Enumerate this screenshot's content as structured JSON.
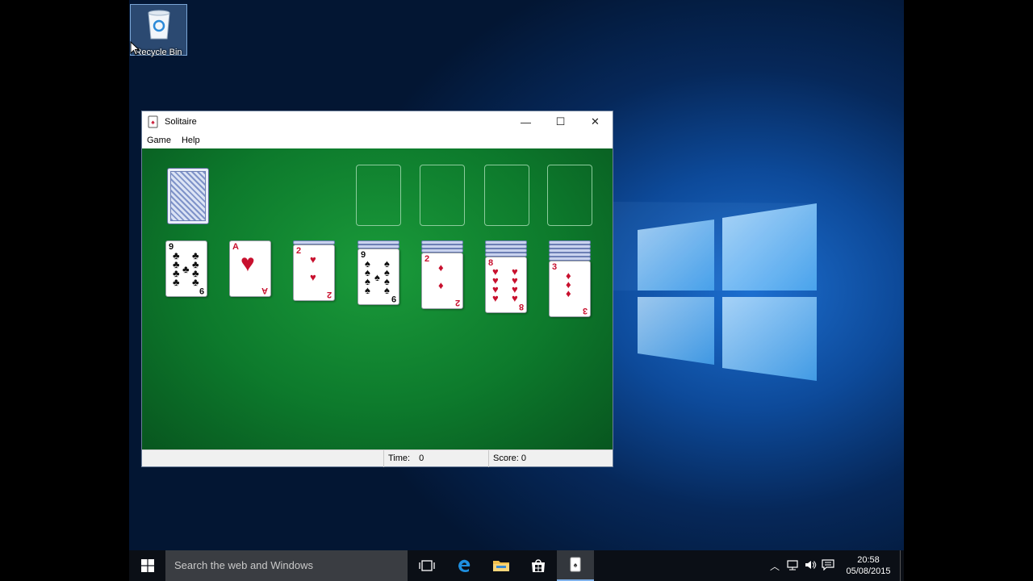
{
  "desktop": {
    "recycle_bin_label": "Recycle Bin"
  },
  "window": {
    "title": "Solitaire",
    "minimize_glyph": "—",
    "maximize_glyph": "☐",
    "close_glyph": "✕",
    "menu": [
      {
        "label": "Game"
      },
      {
        "label": "Help"
      }
    ]
  },
  "game": {
    "stock": "face-down",
    "foundations": 4,
    "tableau": [
      {
        "hidden": 0,
        "rank": "9",
        "suit": "♣",
        "color": "black"
      },
      {
        "hidden": 0,
        "rank": "A",
        "suit": "♥",
        "color": "red"
      },
      {
        "hidden": 1,
        "rank": "2",
        "suit": "♥",
        "color": "red"
      },
      {
        "hidden": 2,
        "rank": "9",
        "suit": "♠",
        "color": "black"
      },
      {
        "hidden": 3,
        "rank": "2",
        "suit": "♦",
        "color": "red"
      },
      {
        "hidden": 4,
        "rank": "8",
        "suit": "♥",
        "color": "red"
      },
      {
        "hidden": 5,
        "rank": "3",
        "suit": "♦",
        "color": "red"
      }
    ]
  },
  "status": {
    "time_label": "Time:",
    "time_value": "0",
    "score_label": "Score: 0"
  },
  "taskbar": {
    "search_placeholder": "Search the web and Windows",
    "clock_time": "20:58",
    "clock_date": "05/08/2015"
  },
  "colors": {
    "felt": "#0d7a2c",
    "card_red": "#c8102e",
    "taskbar": "#0b0f16"
  }
}
